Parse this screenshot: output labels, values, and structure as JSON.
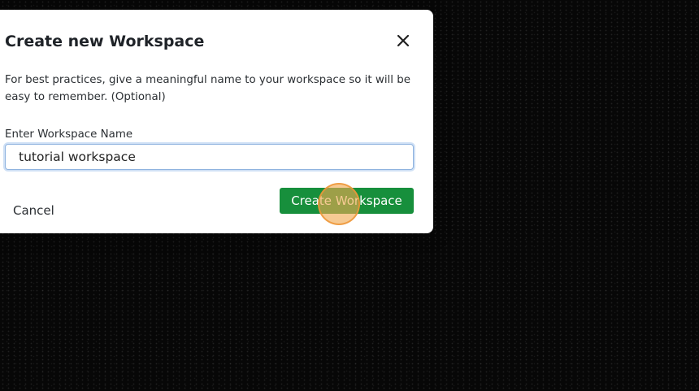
{
  "dialog": {
    "title": "Create new Workspace",
    "description": "For best practices, give a meaningful name to your workspace so it will be easy to remember. (Optional)",
    "close_icon": "close-icon",
    "name_field": {
      "label": "Enter Workspace Name",
      "value": "tutorial workspace"
    },
    "cancel_label": "Cancel",
    "create_label": "Create Workspace"
  },
  "colors": {
    "primary_button": "#178f3c",
    "input_focus": "#8fb3df",
    "click_indicator": "#f0aa50",
    "backdrop": "#070707"
  }
}
